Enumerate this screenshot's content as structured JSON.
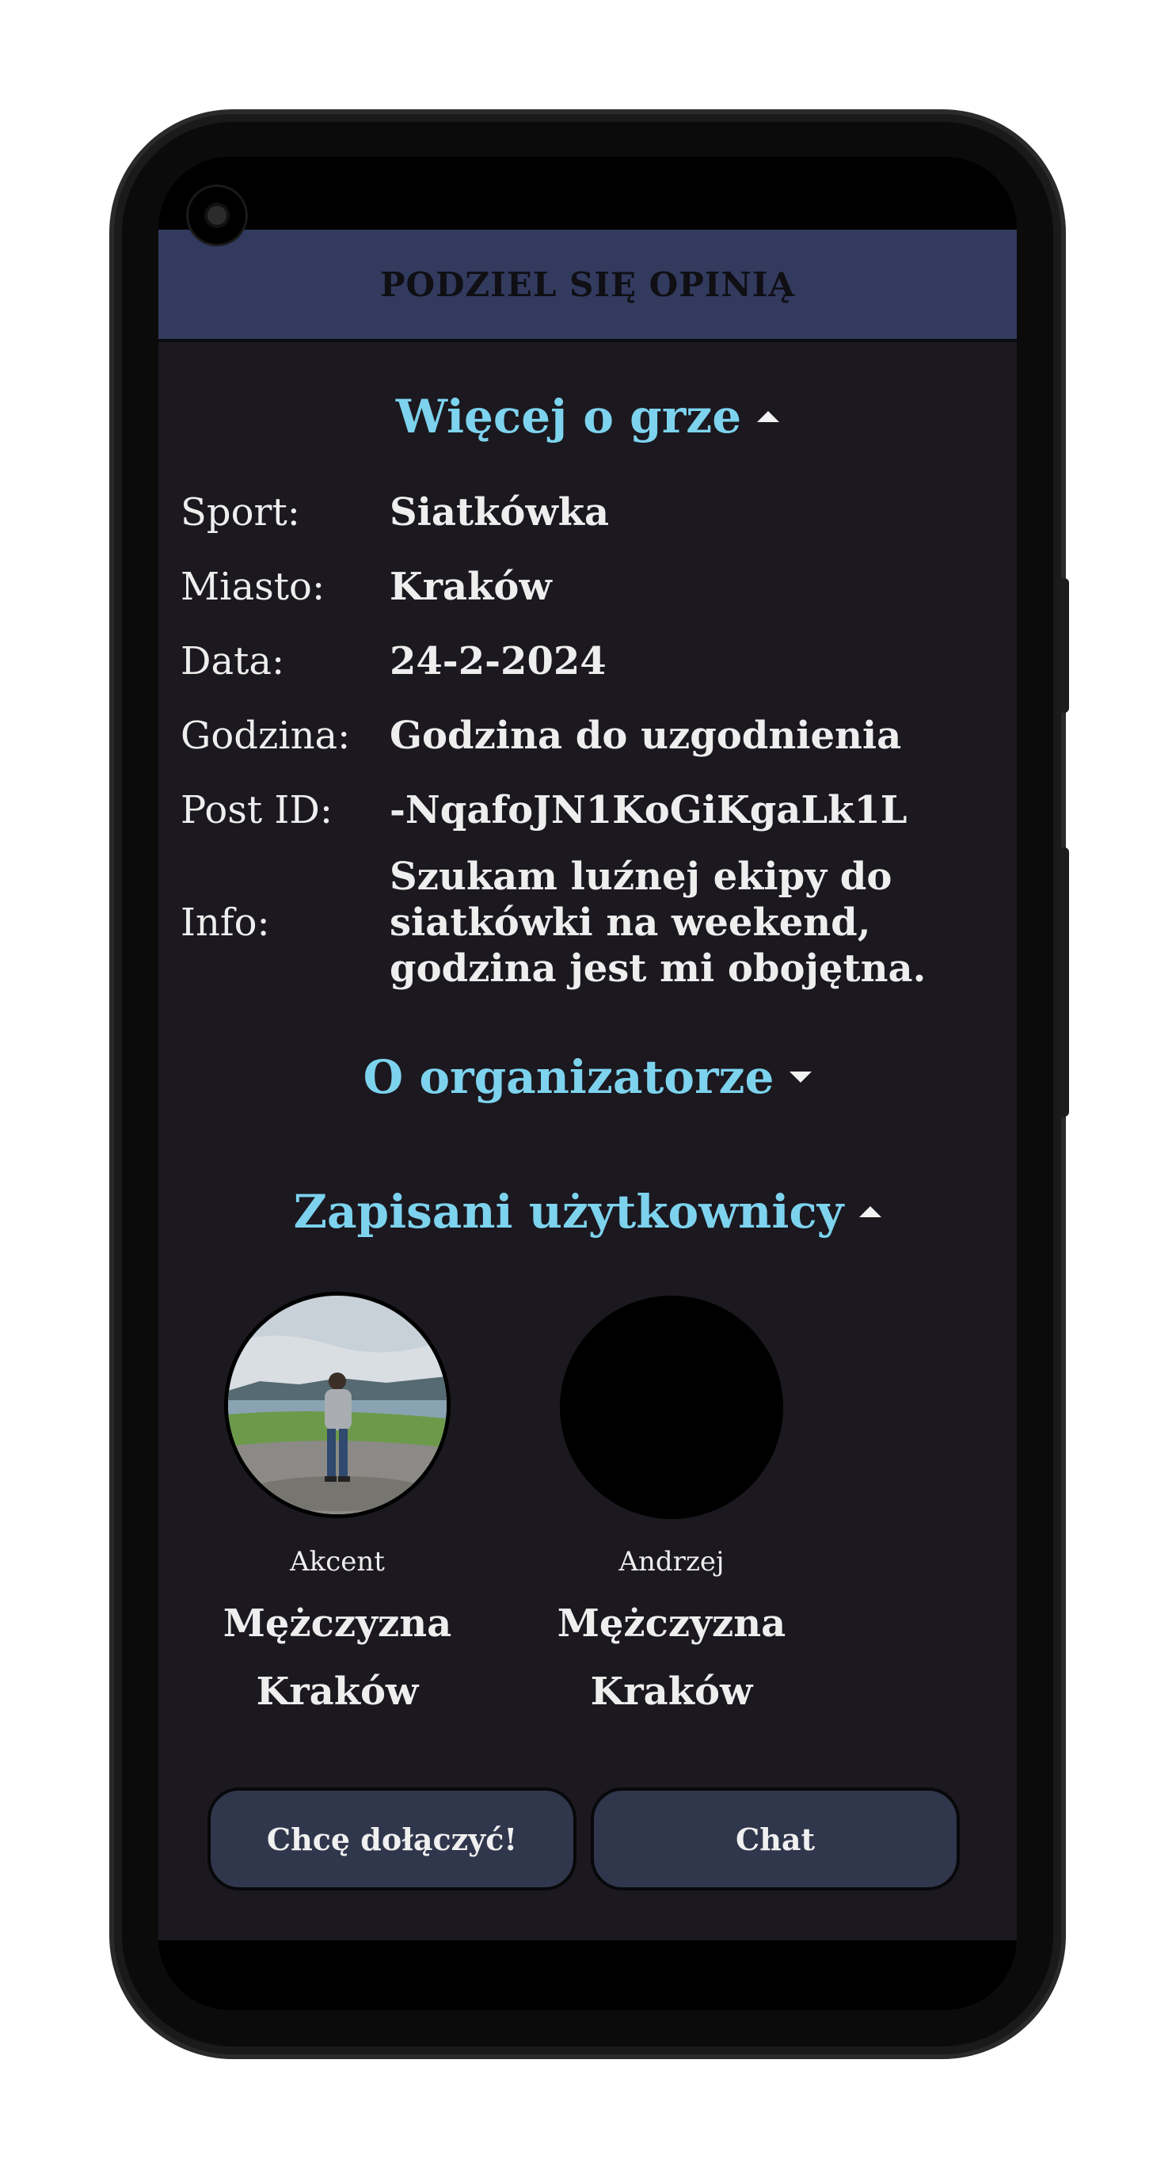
{
  "header": {
    "title": "PODZIEL SIĘ OPINIĄ"
  },
  "game_section": {
    "title": "Więcej o grze",
    "expanded": true,
    "rows": [
      {
        "label": "Sport:",
        "value": "Siatkówka"
      },
      {
        "label": "Miasto:",
        "value": "Kraków"
      },
      {
        "label": "Data:",
        "value": "24-2-2024"
      },
      {
        "label": "Godzina:",
        "value": "Godzina do uzgodnienia"
      },
      {
        "label": "Post ID:",
        "value": "-NqafoJN1KoGiKgaLk1L"
      },
      {
        "label": "Info:",
        "value": "Szukam luźnej ekipy do siatkówki na weekend, godzina jest mi obojętna."
      }
    ]
  },
  "organizer_section": {
    "title": "O organizatorze",
    "expanded": false
  },
  "users_section": {
    "title": "Zapisani użytkownicy",
    "expanded": true,
    "users": [
      {
        "name": "Akcent",
        "gender": "Mężczyzna",
        "city": "Kraków",
        "avatar": "photo-avatar"
      },
      {
        "name": "Andrzej",
        "gender": "Mężczyzna",
        "city": "Kraków",
        "avatar": "blank-avatar"
      }
    ]
  },
  "actions": {
    "join_label": "Chcę dołączyć!",
    "chat_label": "Chat"
  },
  "colors": {
    "accent": "#7dd3ee",
    "topbar": "#323a5e",
    "background": "#1b181f",
    "button": "#30364b"
  }
}
